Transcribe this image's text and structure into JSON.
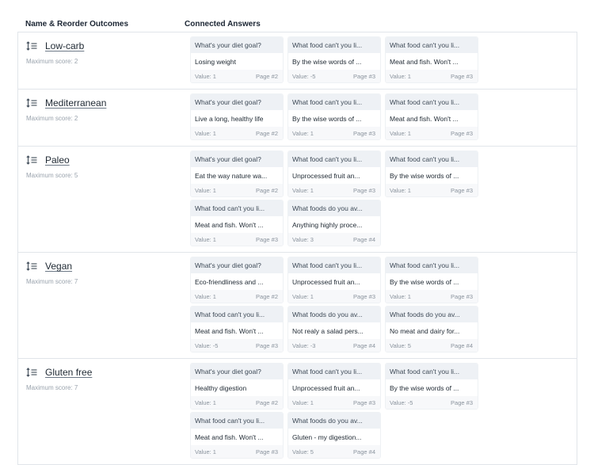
{
  "header": {
    "col1": "Name & Reorder Outcomes",
    "col2": "Connected Answers"
  },
  "max_prefix": "Maximum score: ",
  "outcomes": [
    {
      "name": "Low-carb",
      "max_score": "Maximum score: 2",
      "answers": [
        {
          "q": "What's your diet goal?",
          "a": "Losing weight",
          "value": "Value: 1",
          "page": "Page #2"
        },
        {
          "q": "What food can't you li...",
          "a": "By the wise words of ...",
          "value": "Value: -5",
          "page": "Page #3"
        },
        {
          "q": "What food can't you li...",
          "a": "Meat and fish. Won't ...",
          "value": "Value: 1",
          "page": "Page #3"
        }
      ]
    },
    {
      "name": "Mediterranean",
      "max_score": "Maximum score: 2",
      "answers": [
        {
          "q": "What's your diet goal?",
          "a": "Live a long, healthy life",
          "value": "Value: 1",
          "page": "Page #2"
        },
        {
          "q": "What food can't you li...",
          "a": "By the wise words of ...",
          "value": "Value: 1",
          "page": "Page #3"
        },
        {
          "q": "What food can't you li...",
          "a": "Meat and fish. Won't ...",
          "value": "Value: 1",
          "page": "Page #3"
        }
      ]
    },
    {
      "name": "Paleo",
      "max_score": "Maximum score: 5",
      "answers": [
        {
          "q": "What's your diet goal?",
          "a": "Eat the way nature wa...",
          "value": "Value: 1",
          "page": "Page #2"
        },
        {
          "q": "What food can't you li...",
          "a": "Unprocessed fruit an...",
          "value": "Value: 1",
          "page": "Page #3"
        },
        {
          "q": "What food can't you li...",
          "a": "By the wise words of ...",
          "value": "Value: 1",
          "page": "Page #3"
        },
        {
          "q": "What food can't you li...",
          "a": "Meat and fish. Won't ...",
          "value": "Value: 1",
          "page": "Page #3"
        },
        {
          "q": "What foods do you av...",
          "a": "Anything highly proce...",
          "value": "Value: 3",
          "page": "Page #4"
        }
      ]
    },
    {
      "name": "Vegan",
      "max_score": "Maximum score: 7",
      "answers": [
        {
          "q": "What's your diet goal?",
          "a": "Eco-friendliness and ...",
          "value": "Value: 1",
          "page": "Page #2"
        },
        {
          "q": "What food can't you li...",
          "a": "Unprocessed fruit an...",
          "value": "Value: 1",
          "page": "Page #3"
        },
        {
          "q": "What food can't you li...",
          "a": "By the wise words of ...",
          "value": "Value: 1",
          "page": "Page #3"
        },
        {
          "q": "What food can't you li...",
          "a": "Meat and fish. Won't ...",
          "value": "Value: -5",
          "page": "Page #3"
        },
        {
          "q": "What foods do you av...",
          "a": "Not realy a salad pers...",
          "value": "Value: -3",
          "page": "Page #4"
        },
        {
          "q": "What foods do you av...",
          "a": "No meat and dairy for...",
          "value": "Value: 5",
          "page": "Page #4"
        }
      ]
    },
    {
      "name": "Gluten free",
      "max_score": "Maximum score: 7",
      "answers": [
        {
          "q": "What's your diet goal?",
          "a": "Healthy digestion",
          "value": "Value: 1",
          "page": "Page #2"
        },
        {
          "q": "What food can't you li...",
          "a": "Unprocessed fruit an...",
          "value": "Value: 1",
          "page": "Page #3"
        },
        {
          "q": "What food can't you li...",
          "a": "By the wise words of ...",
          "value": "Value: -5",
          "page": "Page #3"
        },
        {
          "q": "What food can't you li...",
          "a": "Meat and fish. Won't ...",
          "value": "Value: 1",
          "page": "Page #3"
        },
        {
          "q": "What foods do you av...",
          "a": "Gluten - my digestion...",
          "value": "Value: 5",
          "page": "Page #4"
        }
      ]
    }
  ],
  "icons": {
    "reorder": "reorder-icon"
  }
}
